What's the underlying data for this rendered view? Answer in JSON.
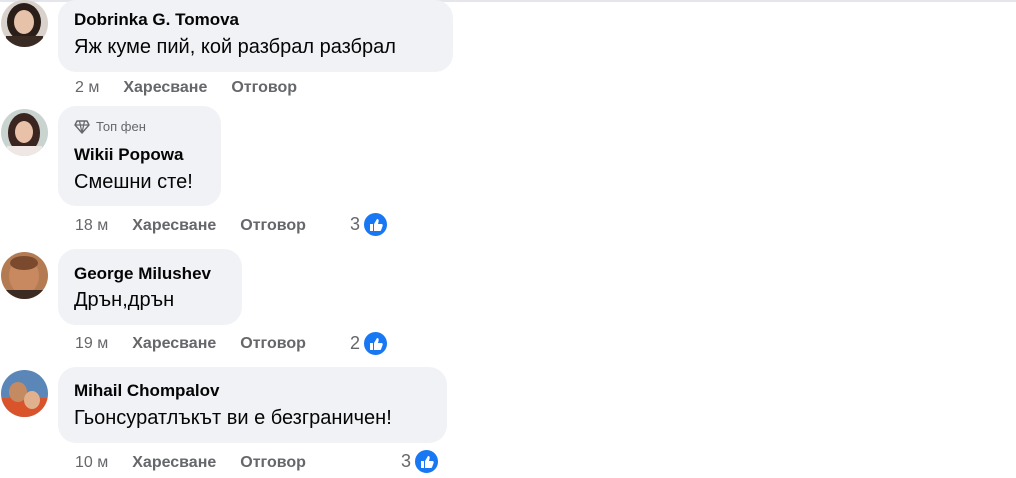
{
  "comments": [
    {
      "author": "Dobrinka G. Tomova",
      "badge": "",
      "text": "Яж куме пий, кой разбрал разбрал",
      "time": "2 м",
      "like_label": "Харесване",
      "reply_label": "Отговор",
      "reactions": ""
    },
    {
      "author": "Wikii Popowa",
      "badge": "Топ фен",
      "text": "Смешни сте!",
      "time": "18 м",
      "like_label": "Харесване",
      "reply_label": "Отговор",
      "reactions": "3"
    },
    {
      "author": "George Milushev",
      "badge": "",
      "text": "Дрън,дрън",
      "time": "19 м",
      "like_label": "Харесване",
      "reply_label": "Отговор",
      "reactions": "2"
    },
    {
      "author": "Mihail Chompalov",
      "badge": "",
      "text": "Гьонсуратлъкът ви е безграничен!",
      "time": "10 м",
      "like_label": "Харесване",
      "reply_label": "Отговор",
      "reactions": "3"
    }
  ],
  "icons": {
    "badge_icon": "diamond-icon",
    "reaction_icon": "thumbs-up-icon"
  },
  "colors": {
    "bubble": "#f0f2f5",
    "like_blue": "#1877f2",
    "meta_gray": "#65676b"
  }
}
